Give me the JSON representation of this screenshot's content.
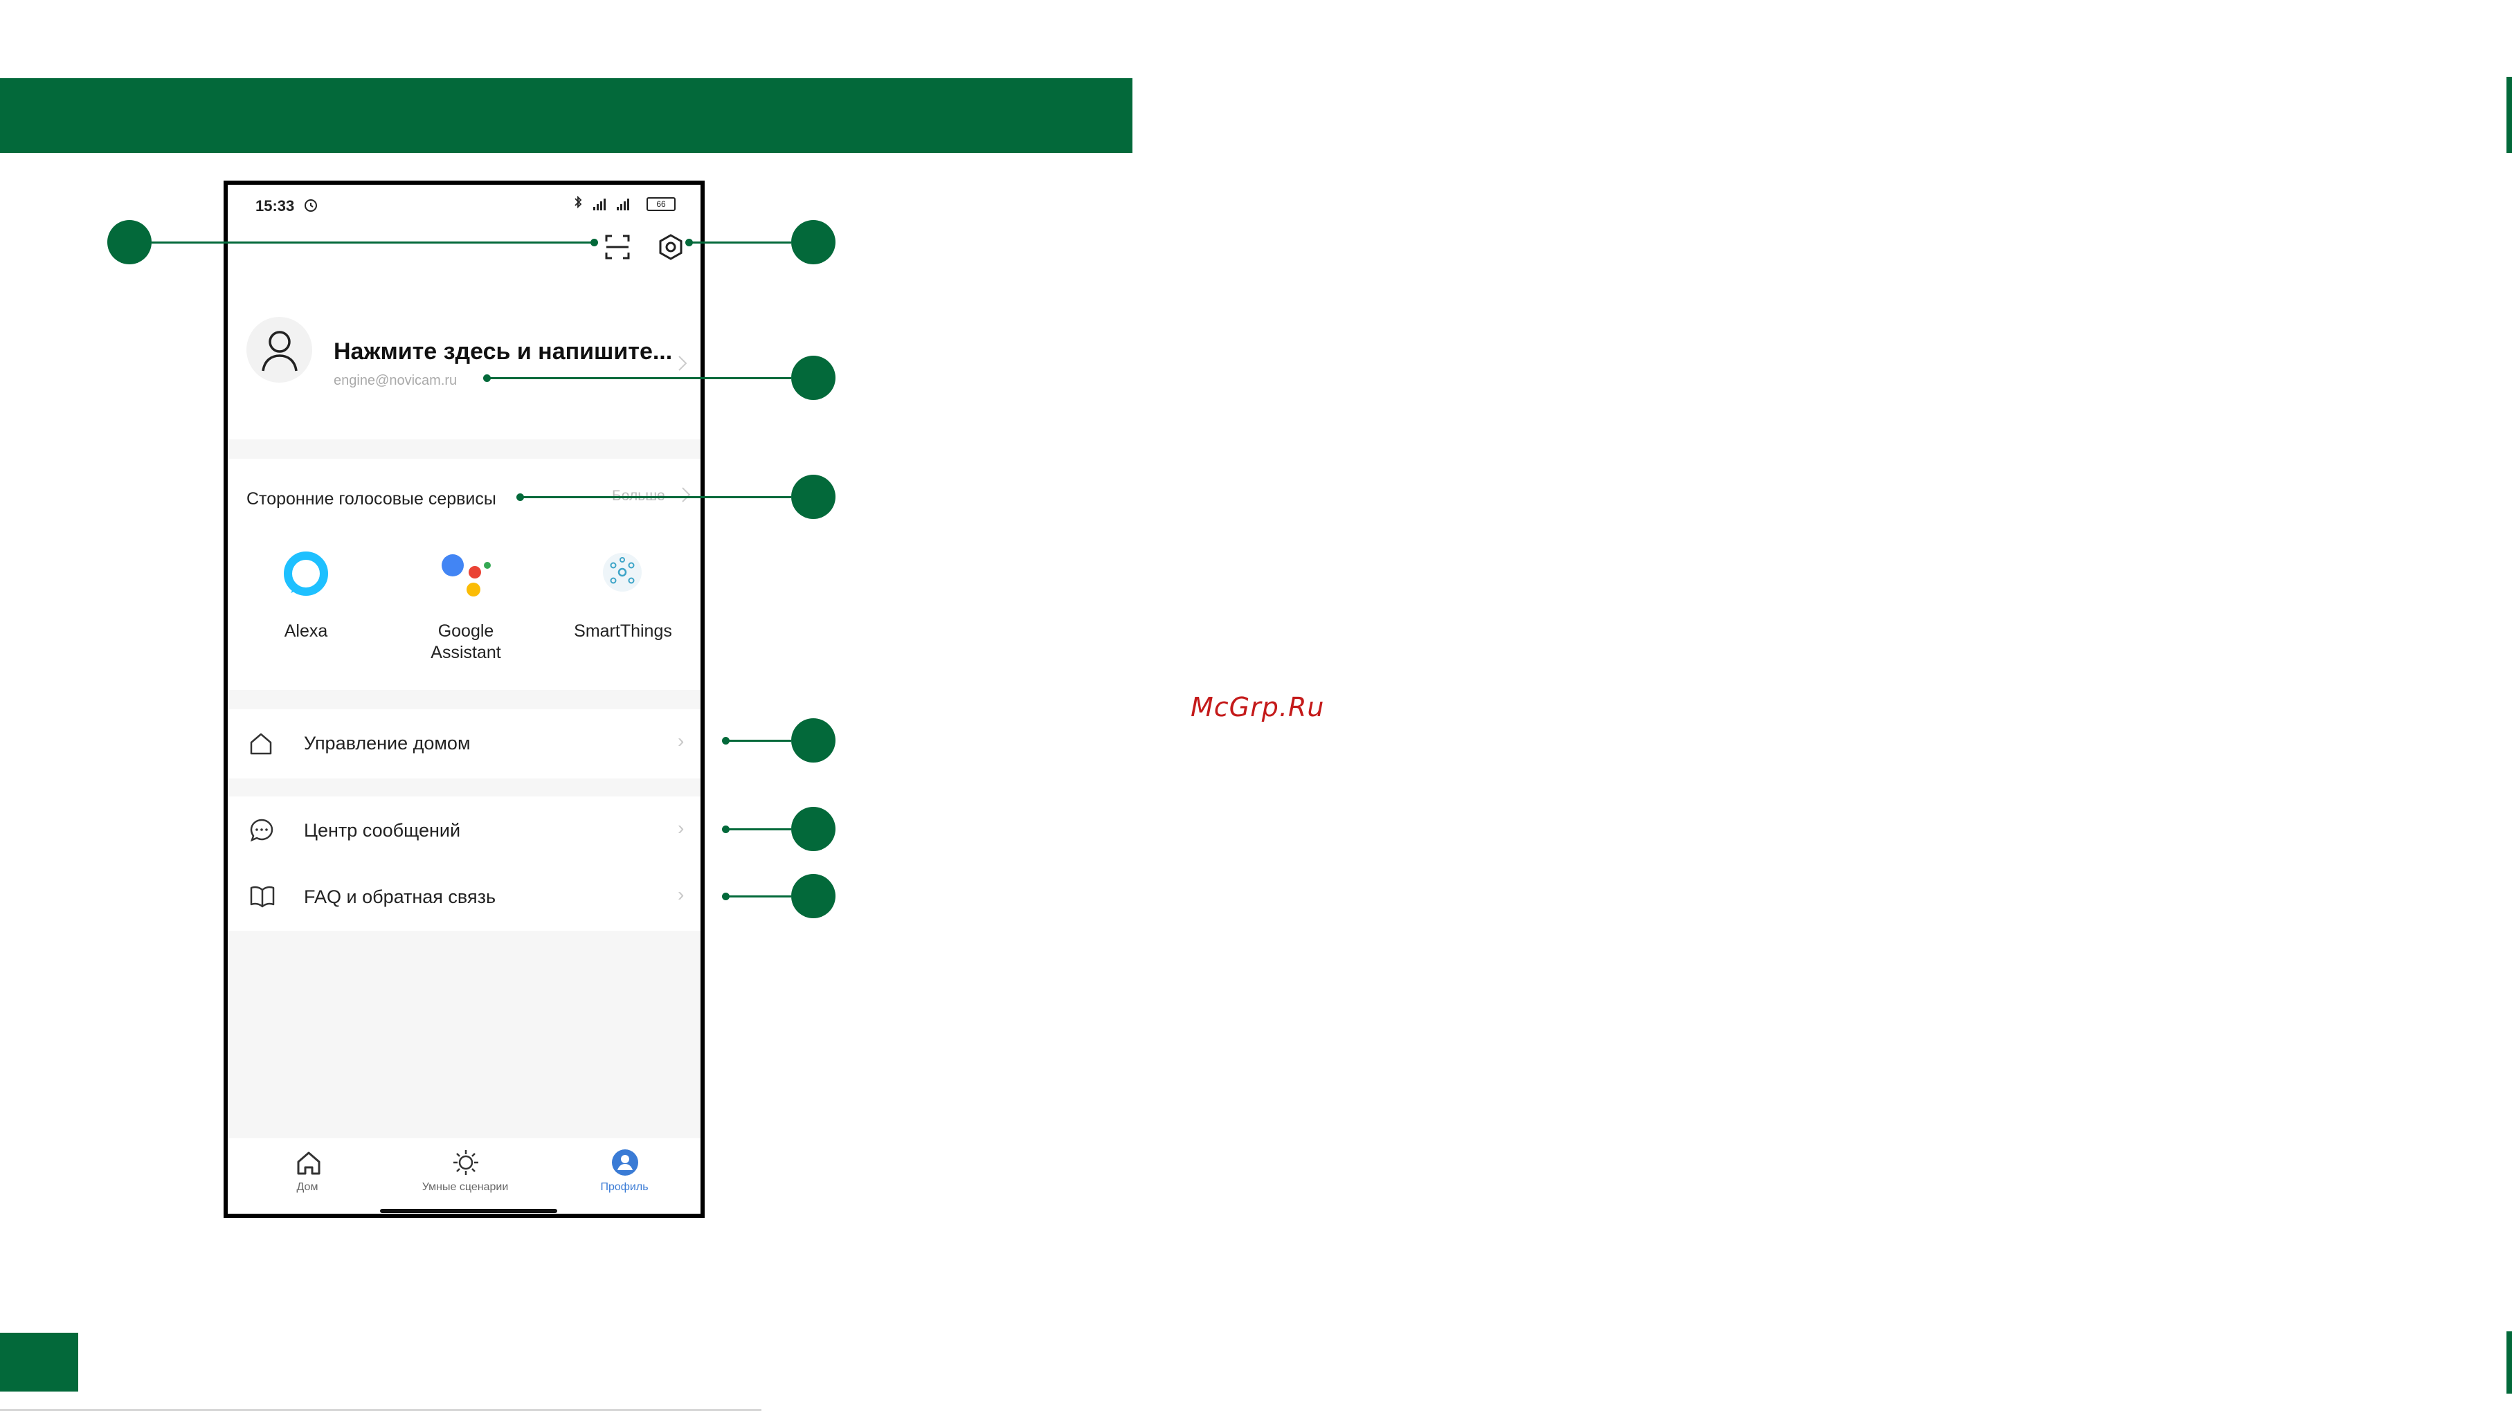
{
  "status_bar": {
    "time": "15:33",
    "battery": "66"
  },
  "profile": {
    "name": "Нажмите здесь и напишите...",
    "email": "engine@novicam.ru"
  },
  "voice_services": {
    "title": "Сторонние голосовые сервисы",
    "more": "Больше",
    "items": [
      {
        "label": "Alexa",
        "icon": "alexa-icon"
      },
      {
        "label": "Google\nAssistant",
        "icon": "google-assistant-icon"
      },
      {
        "label": "SmartThings",
        "icon": "smartthings-icon"
      }
    ]
  },
  "menu": {
    "home_management": "Управление домом",
    "message_center": "Центр сообщений",
    "faq": "FAQ и обратная связь"
  },
  "tabs": [
    {
      "label": "Дом",
      "icon": "home-icon",
      "active": false
    },
    {
      "label": "Умные сценарии",
      "icon": "sun-icon",
      "active": false
    },
    {
      "label": "Профиль",
      "icon": "profile-icon",
      "active": true
    }
  ],
  "watermark": "McGrp.Ru",
  "colors": {
    "accent": "#03693a",
    "active_tab": "#3a7bd5",
    "watermark": "#c41a1a"
  }
}
